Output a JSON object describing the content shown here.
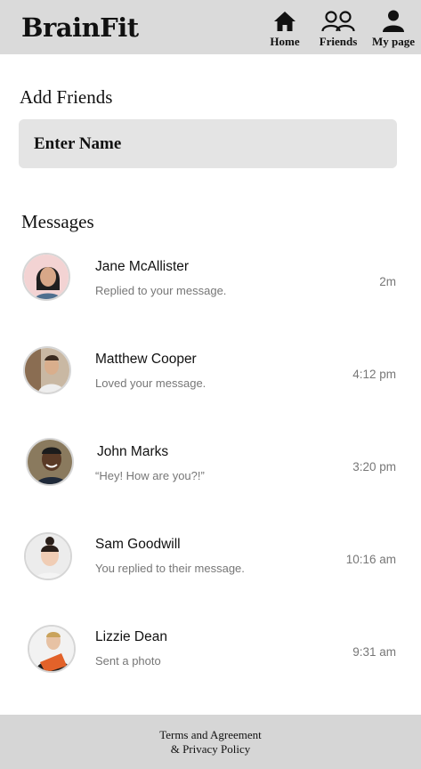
{
  "header": {
    "brand": "BrainFit",
    "nav": [
      {
        "label": "Home",
        "icon": "home-icon"
      },
      {
        "label": "Friends",
        "icon": "friends-icon"
      },
      {
        "label": "My page",
        "icon": "user-icon"
      }
    ]
  },
  "add_friends": {
    "title": "Add Friends",
    "placeholder": "Enter Name"
  },
  "messages": {
    "title": "Messages",
    "items": [
      {
        "name": "Jane McAllister",
        "preview": "Replied to your message.",
        "time": "2m"
      },
      {
        "name": "Matthew Cooper",
        "preview": "Loved your message.",
        "time": "4:12 pm"
      },
      {
        "name": "John Marks",
        "preview": "“Hey! How are you?!”",
        "time": "3:20 pm"
      },
      {
        "name": "Sam Goodwill",
        "preview": "You replied to their message.",
        "time": "10:16 am"
      },
      {
        "name": "Lizzie Dean",
        "preview": "Sent a photo",
        "time": "9:31 am"
      }
    ]
  },
  "footer": {
    "line1": "Terms and Agreement",
    "line2": "& Privacy Policy"
  }
}
